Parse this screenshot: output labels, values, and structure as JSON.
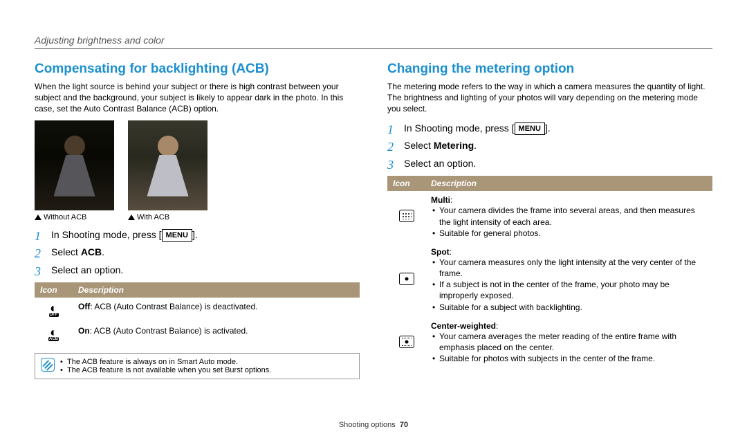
{
  "header": {
    "breadcrumb": "Adjusting brightness and color"
  },
  "left": {
    "title": "Compensating for backlighting (ACB)",
    "intro": "When the light source is behind your subject or there is high contrast between your subject and the background, your subject is likely to appear dark in the photo. In this case, set the Auto Contrast Balance (ACB) option.",
    "fig_without": "Without ACB",
    "fig_with": "With ACB",
    "step1_pre": "In Shooting mode, press [",
    "step1_btn": "MENU",
    "step1_post": "].",
    "step2_pre": "Select ",
    "step2_bold": "ACB",
    "step2_post": ".",
    "step3": "Select an option.",
    "th_icon": "Icon",
    "th_desc": "Description",
    "row1_bold": "Off",
    "row1_rest": ": ACB (Auto Contrast Balance) is deactivated.",
    "row2_bold": "On",
    "row2_rest": ": ACB (Auto Contrast Balance) is activated.",
    "note1": "The ACB feature is always on in Smart Auto mode.",
    "note2": "The ACB feature is not available when you set Burst options.",
    "icon_off_sub": "OFF",
    "icon_on_sub": "ACB"
  },
  "right": {
    "title": "Changing the metering option",
    "intro": "The metering mode refers to the way in which a camera measures the quantity of light. The brightness and lighting of your photos will vary depending on the metering mode you select.",
    "step1_pre": "In Shooting mode, press [",
    "step1_btn": "MENU",
    "step1_post": "].",
    "step2_pre": "Select ",
    "step2_bold": "Metering",
    "step2_post": ".",
    "step3": "Select an option.",
    "th_icon": "Icon",
    "th_desc": "Description",
    "multi_label": "Multi",
    "multi_b1": "Your camera divides the frame into several areas, and then measures the light intensity of each area.",
    "multi_b2": "Suitable for general photos.",
    "spot_label": "Spot",
    "spot_b1": "Your camera measures only the light intensity at the very center of the frame.",
    "spot_b2": "If a subject is not in the center of the frame, your photo may be improperly exposed.",
    "spot_b3": "Suitable for a subject with backlighting.",
    "center_label": "Center-weighted",
    "center_b1": "Your camera averages the meter reading of the entire frame with emphasis placed on the center.",
    "center_b2": "Suitable for photos with subjects in the center of the frame."
  },
  "footer": {
    "section": "Shooting options",
    "page": "70"
  }
}
